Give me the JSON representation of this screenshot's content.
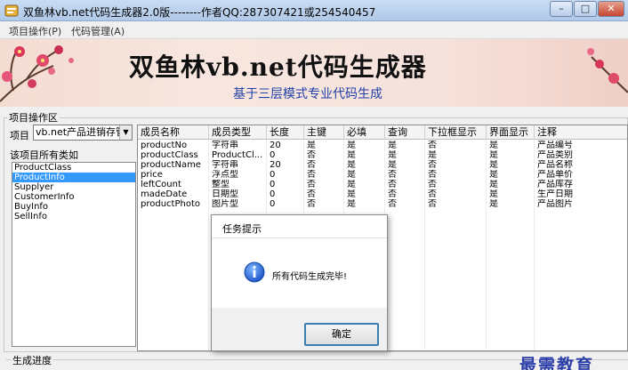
{
  "window": {
    "title": "双鱼林vb.net代码生成器2.0版--------作者QQ:287307421或254540457",
    "minimize_glyph": "–",
    "maximize_glyph": "□",
    "close_glyph": "✕"
  },
  "menu": {
    "items": [
      "项目操作(P)",
      "代码管理(A)"
    ]
  },
  "banner": {
    "title": "双鱼林vb.net代码生成器",
    "subtitle": "基于三层模式专业代码生成"
  },
  "project_group": {
    "label": "项目操作区",
    "project_label": "项目",
    "project_value": "vb.net产品进销存管",
    "classes_label": "该项目所有类如",
    "classes": [
      "ProductClass",
      "ProductInfo",
      "Supplyer",
      "CustomerInfo",
      "BuyInfo",
      "SellInfo"
    ],
    "selected_index": 1
  },
  "grid": {
    "columns": [
      "成员名称",
      "成员类型",
      "长度",
      "主键",
      "必填",
      "查询",
      "下拉框显示",
      "界面显示",
      "注释"
    ],
    "rows": [
      [
        "productNo",
        "字符串",
        "20",
        "是",
        "是",
        "是",
        "否",
        "是",
        "产品编号"
      ],
      [
        "productClass",
        "ProductCl...",
        "0",
        "否",
        "是",
        "是",
        "是",
        "是",
        "产品类别"
      ],
      [
        "productName",
        "字符串",
        "20",
        "否",
        "是",
        "是",
        "否",
        "是",
        "产品名称"
      ],
      [
        "price",
        "浮点型",
        "0",
        "否",
        "是",
        "否",
        "否",
        "是",
        "产品单价"
      ],
      [
        "leftCount",
        "整型",
        "0",
        "否",
        "是",
        "否",
        "否",
        "是",
        "产品库存"
      ],
      [
        "madeDate",
        "日期型",
        "0",
        "否",
        "是",
        "否",
        "否",
        "是",
        "生产日期"
      ],
      [
        "productPhoto",
        "图片型",
        "0",
        "否",
        "是",
        "否",
        "否",
        "是",
        "产品图片"
      ]
    ]
  },
  "dialog": {
    "title": "任务提示",
    "message": "所有代码生成完毕!",
    "ok_label": "确定",
    "icon": "info-icon"
  },
  "progress": {
    "label": "生成进度"
  },
  "watermark": {
    "text": "最需教育"
  },
  "colors": {
    "selection": "#3399ff",
    "banner_subtitle": "#1f3fa8",
    "watermark": "#2c3fa8"
  }
}
